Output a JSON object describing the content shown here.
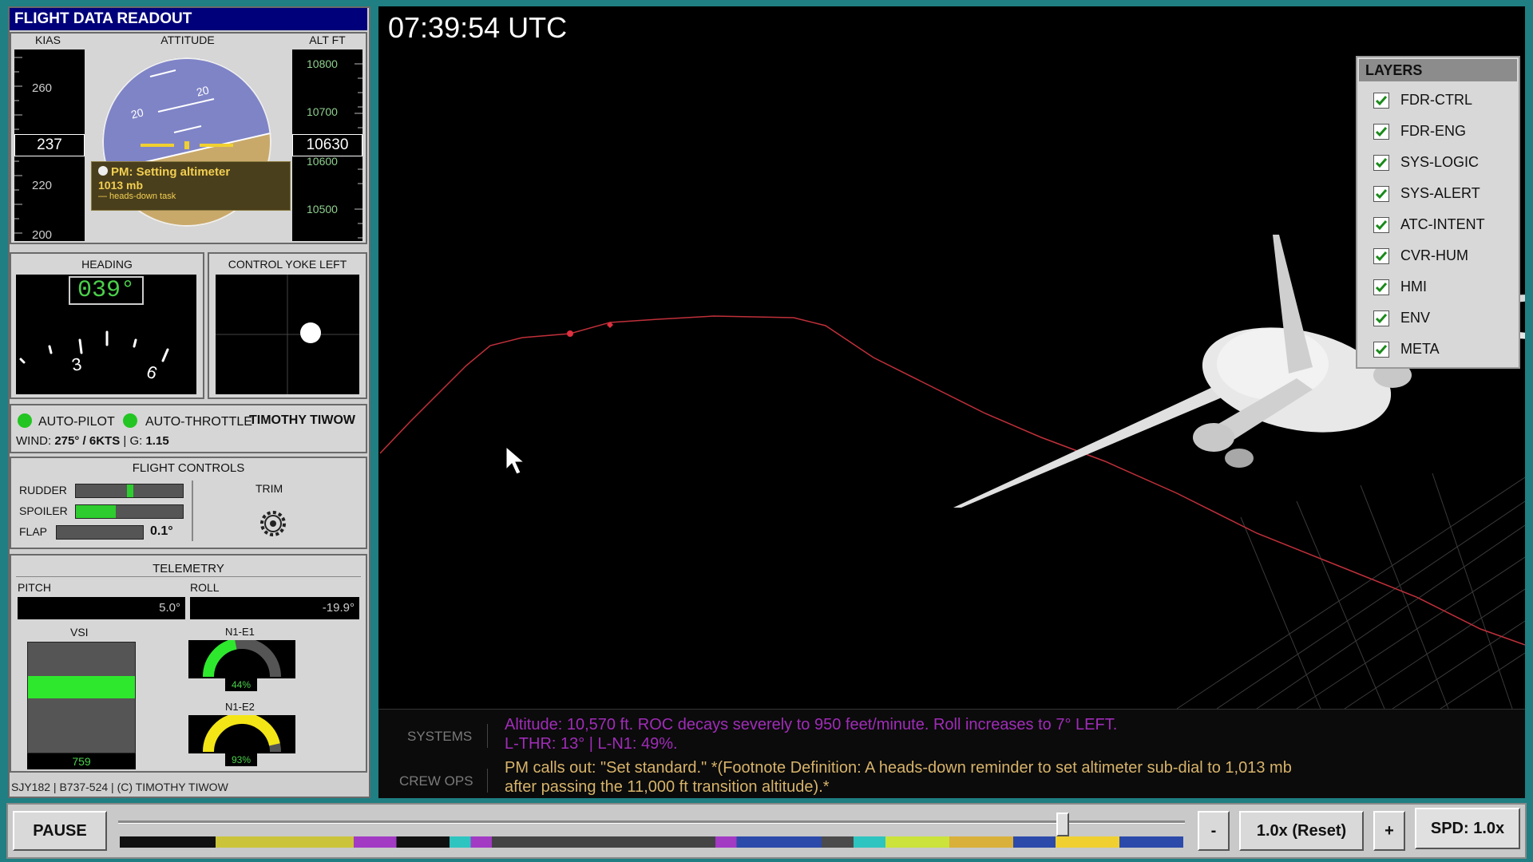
{
  "header": {
    "title": "FLIGHT DATA READOUT"
  },
  "pfd": {
    "kias_label": "KIAS",
    "attitude_label": "ATTITUDE",
    "alt_label": "ALT FT",
    "speed_ticks": [
      "260",
      "220",
      "200"
    ],
    "speed_value": "237",
    "alt_ticks": [
      "10800",
      "10700",
      "10600",
      "10500"
    ],
    "alt_value": "10630",
    "pitch_marks": [
      "20",
      "20"
    ],
    "callout_line1": "PM: Setting altimeter",
    "callout_line2": "1013 mb",
    "callout_line3": "— heads-down task"
  },
  "heading": {
    "label": "HEADING",
    "value": "039°",
    "tick3": "3",
    "tick6": "6"
  },
  "yoke": {
    "label": "CONTROL YOKE LEFT"
  },
  "status": {
    "autopilot": "AUTO-PILOT",
    "autothrottle": "AUTO-THROTTLE",
    "pilot_name": "TIMOTHY TIWOW",
    "wind_label": "WIND:",
    "wind_value": "275° / 6KTS",
    "g_label": "| G:",
    "g_value": "1.15",
    "indicator_color": "#22c522"
  },
  "flight_controls": {
    "title": "FLIGHT CONTROLS",
    "rudder": "RUDDER",
    "spoiler": "SPOILER",
    "flap": "FLAP",
    "flap_value": "0.1°",
    "trim": "TRIM"
  },
  "telemetry": {
    "title": "TELEMETRY",
    "pitch_label": "PITCH",
    "pitch_value": "5.0°",
    "roll_label": "ROLL",
    "roll_value": "-19.9°",
    "vsi_label": "VSI",
    "vsi_value": "759",
    "n1e1_label": "N1-E1",
    "n1e1_value": "44%",
    "n1e1_level": 0.44,
    "n1e2_label": "N1-E2",
    "n1e2_value": "93%",
    "n1e2_level": 0.93
  },
  "footer_info": "SJY182 | B737-524 | (C) TIMOTHY TIWOW",
  "viewport": {
    "clock": "07:39:54 UTC"
  },
  "layers": {
    "title": "LAYERS",
    "items": [
      "FDR-CTRL",
      "FDR-ENG",
      "SYS-LOGIC",
      "SYS-ALERT",
      "ATC-INTENT",
      "CVR-HUM",
      "HMI",
      "ENV",
      "META"
    ]
  },
  "log": {
    "systems_label": "SYSTEMS",
    "systems_text1": "Altitude: 10,570 ft. ROC decays severely to 950 feet/minute. Roll increases to 7° LEFT.",
    "systems_text2": "L-THR: 13° | L-N1: 49%.",
    "crew_label": "CREW OPS",
    "crew_text1": "PM calls out: \"Set standard.\" *(Footnote Definition: A heads-down reminder to set altimeter sub-dial to 1,013 mb",
    "crew_text2": "after passing the 11,000 ft transition altitude).*"
  },
  "controls": {
    "pause": "PAUSE",
    "minus": "-",
    "reset": "1.0x (Reset)",
    "plus": "+",
    "speed": "SPD: 1.0x",
    "progress": 0.89
  }
}
